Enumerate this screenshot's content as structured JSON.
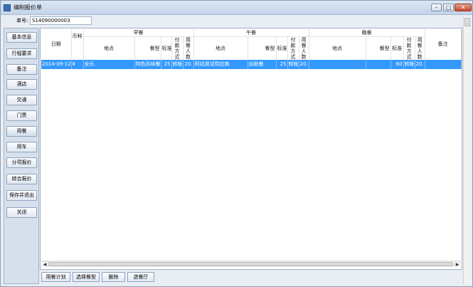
{
  "window": {
    "title": "编制报价单",
    "controls": {
      "minimize": "–",
      "maximize": "□",
      "close": "✕"
    }
  },
  "order": {
    "label": "单号:",
    "value": "S14090000003"
  },
  "sidebar": {
    "items": [
      "基本信息",
      "行程要求",
      "备注",
      "酒店",
      "交通",
      "门票",
      "用餐",
      "用车",
      "分项报价",
      "综合报价",
      "保存并退出",
      "关闭"
    ],
    "selected_index": 6
  },
  "grid": {
    "columns": {
      "date": "日期",
      "currency": "币种",
      "remark": "备注",
      "groups": [
        "早餐",
        "午餐",
        "晚餐"
      ],
      "sub": {
        "place": "地点",
        "meal_type": "餐型",
        "standard": "标准",
        "pay_method": "付款方式",
        "persons": "用餐人数"
      }
    },
    "rows": [
      {
        "date": "2014-09-12",
        "currency": "¥",
        "breakfast": {
          "place": "全乐.",
          "meal_type": "特色风味餐",
          "standard": "25",
          "pay": "转帐",
          "persons": "20."
        },
        "lunch": {
          "place": "阿站测试供应商",
          "meal_type": "自助餐",
          "standard": "25",
          "pay": "转帐",
          "persons": "20."
        },
        "dinner": {
          "place": "",
          "meal_type": "",
          "standard": "60",
          "pay": "转帐",
          "persons": "20."
        },
        "remark": ""
      }
    ]
  },
  "bottom": {
    "buttons": [
      "用餐计划",
      "选择餐型",
      "删除",
      "选餐厅"
    ]
  },
  "colors": {
    "selection": "#3399ff",
    "sidebar_bg": "#d6e0ec",
    "window_bg": "#e9eef4"
  }
}
